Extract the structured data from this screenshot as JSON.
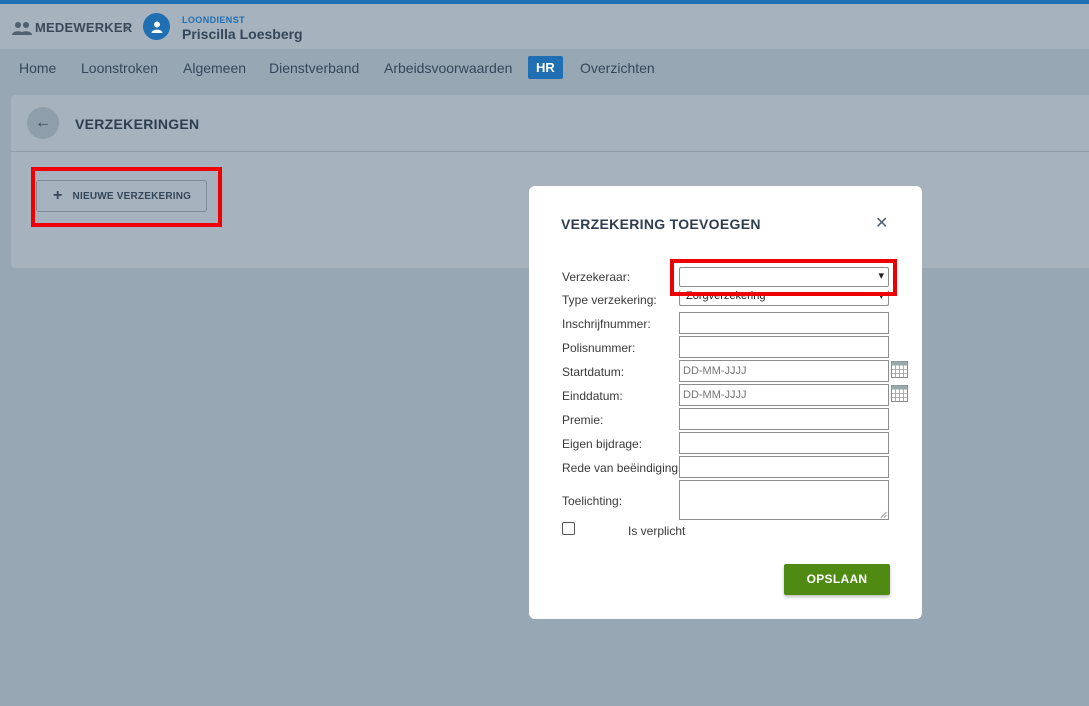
{
  "header": {
    "breadcrumb_label": "MEDEWERKER",
    "subtitle": "LOONDIENST",
    "person_name": "Priscilla Loesberg"
  },
  "nav": {
    "items": [
      {
        "label": "Home"
      },
      {
        "label": "Loonstroken"
      },
      {
        "label": "Algemeen"
      },
      {
        "label": "Dienstverband"
      },
      {
        "label": "Arbeidsvoorwaarden"
      },
      {
        "label": "HR",
        "active": true
      },
      {
        "label": "Overzichten"
      }
    ]
  },
  "panel": {
    "title": "VERZEKERINGEN",
    "new_button_label": "NIEUWE VERZEKERING"
  },
  "modal": {
    "title": "VERZEKERING TOEVOEGEN",
    "fields": {
      "verzekeraar": {
        "label": "Verzekeraar:",
        "value": ""
      },
      "type": {
        "label": "Type verzekering:",
        "value": "Zorgverzekering"
      },
      "inschrijfnummer": {
        "label": "Inschrijfnummer:",
        "value": ""
      },
      "polisnummer": {
        "label": "Polisnummer:",
        "value": ""
      },
      "startdatum": {
        "label": "Startdatum:",
        "placeholder": "DD-MM-JJJJ"
      },
      "einddatum": {
        "label": "Einddatum:",
        "placeholder": "DD-MM-JJJJ"
      },
      "premie": {
        "label": "Premie:",
        "value": ""
      },
      "eigen_bijdrage": {
        "label": "Eigen bijdrage:",
        "value": ""
      },
      "rede": {
        "label": "Rede van beëindiging:",
        "value": ""
      },
      "toelichting": {
        "label": "Toelichting:",
        "value": ""
      }
    },
    "checkbox_label": "Is verplicht",
    "checkbox_checked": false,
    "save_label": "OPSLAAN"
  },
  "colors": {
    "accent": "#1f6fb2",
    "save": "#4f8a12",
    "highlight": "#ee0000"
  }
}
